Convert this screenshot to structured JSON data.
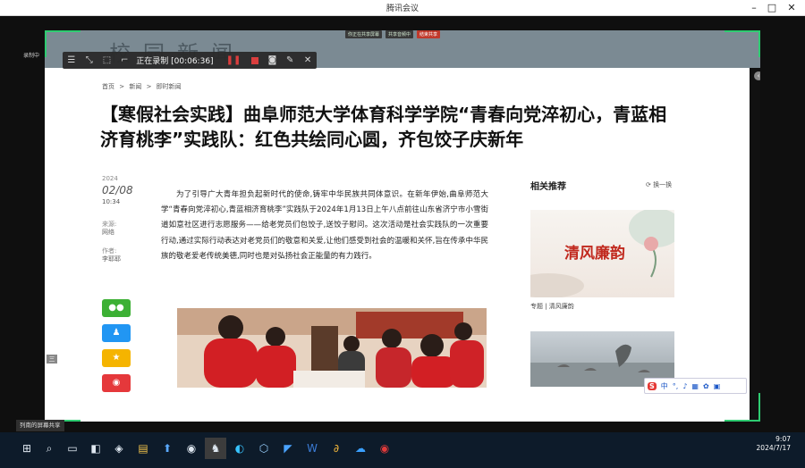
{
  "window": {
    "title": "腾讯会议"
  },
  "share_notices": [
    "你正在共享屏幕",
    "共享音频中",
    "结束共享"
  ],
  "banner": {
    "text": "校园新闻"
  },
  "recorder": {
    "status": "正在录制 [00:06:36]",
    "corner_label": "录制中"
  },
  "breadcrumb": [
    "首页",
    ">",
    "新闻",
    ">",
    "即时新闻"
  ],
  "headline": "【寒假社会实践】曲阜师范大学体育科学学院“青春向党淬初心，青蓝相济育桃李”实践队：红色共绘同心圆，齐包饺子庆新年",
  "meta": {
    "year": "2024",
    "date": "02/08",
    "time": "10:34",
    "source_label": "来源:",
    "source": "网络",
    "author_label": "作者:",
    "author": "李耶耶"
  },
  "article": [
    "为了引导广大青年担负起新时代的使命,铸牢中华民族共同体意识。在新年伊始,曲阜师范大学“青春向党淬初心,青蓝相济育桃李”实践队于2024年1月13日上午八点前往山东省济宁市小雪街道如意社区进行志愿服务——给老党员们包饺子,送饺子慰问。这次活动是社会实践队的一次重要行动,通过实际行动表达对老党员们的敬意和关爱,让他们感受到社会的温暖和关怀,旨在传承中华民族的敬老爱老传统美德,同时也是对弘扬社会正能量的有力践行。"
  ],
  "related": {
    "title": "相关推荐",
    "refresh": "换一换",
    "card1_text": "清风廉韵",
    "card1_caption": "专题 | 清风廉韵"
  },
  "ime": {
    "label": "中"
  },
  "side_tab": "三",
  "bottom_status": "列南的屏幕共享",
  "clock": {
    "time": "9:07",
    "date": "2024/7/17"
  },
  "colors": {
    "headline": "#111111",
    "banner": "#7b8a93",
    "accent_red": "#c12a1f",
    "share_green": "#2ecc71",
    "taskbar": "#0d1b2a"
  },
  "icons": [
    "wechat-icon",
    "qq-icon",
    "qzone-icon",
    "weibo-icon"
  ]
}
